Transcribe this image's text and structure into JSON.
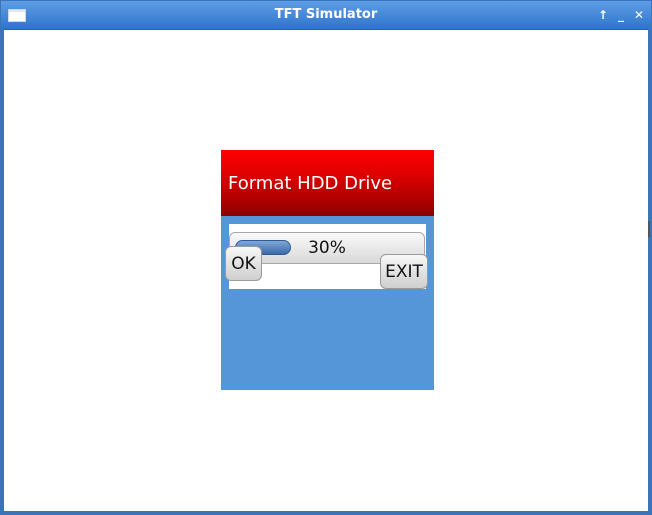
{
  "window": {
    "title": "TFT Simulator",
    "controls": {
      "up_symbol": "↑",
      "minimize_symbol": "_",
      "close_symbol": "✕"
    }
  },
  "dialog": {
    "title": "Format HDD Drive",
    "progress": {
      "value_percent": 30,
      "label": "30%"
    },
    "buttons": {
      "ok_label": "OK",
      "exit_label": "EXIT"
    },
    "colors": {
      "header_red": "#ff0000",
      "background_blue": "#5496d8",
      "progress_blue": "#3b6aa8"
    }
  }
}
